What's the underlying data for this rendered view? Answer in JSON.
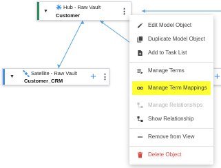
{
  "nodes": {
    "hub": {
      "type": "Hub - Raw Vault",
      "name": "Customer",
      "accent_color": "#2e8b57"
    },
    "satellite": {
      "type": "Satellite - Raw Vault",
      "name": "Customer_CRM",
      "accent_color": "#4a90e2"
    }
  },
  "context_menu": {
    "items": [
      {
        "label": "Edit Model Object",
        "icon": "pencil-icon",
        "state": "enabled"
      },
      {
        "label": "Duplicate Model Object",
        "icon": "copy-icon",
        "state": "enabled"
      },
      {
        "label": "Add to Task List",
        "icon": "task-add-icon",
        "state": "enabled"
      },
      {
        "label": "Manage Terms",
        "icon": "terms-icon",
        "state": "enabled"
      },
      {
        "label": "Manage Term Mappings",
        "icon": "link-icon",
        "state": "highlighted"
      },
      {
        "label": "Manage Relationships",
        "icon": "relationships-icon",
        "state": "disabled"
      },
      {
        "label": "Show Relationship",
        "icon": "show-relationship-icon",
        "state": "enabled"
      },
      {
        "label": "Remove from View",
        "icon": "minus-icon",
        "state": "enabled"
      },
      {
        "label": "Delete Object",
        "icon": "trash-icon",
        "state": "danger"
      }
    ],
    "highlight_color": "#ffff33",
    "danger_color": "#e0453f"
  },
  "connector_color": "#5aa6e0"
}
